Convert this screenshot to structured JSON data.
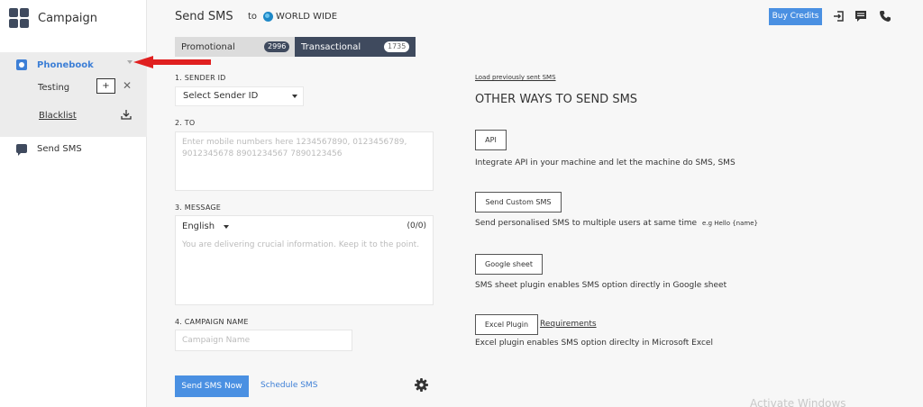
{
  "sidebar": {
    "brand": "Campaign",
    "phonebook_label": "Phonebook",
    "testing_label": "Testing",
    "plus_label": "+",
    "close_label": "✕",
    "blacklist_label": "Blacklist",
    "send_sms_label": "Send SMS"
  },
  "header": {
    "title": "Send SMS",
    "to": "to",
    "region": "WORLD WIDE",
    "buy_credits": "Buy Credits"
  },
  "tabs": {
    "promotional": "Promotional",
    "promotional_count": "2996",
    "transactional": "Transactional",
    "transactional_count": "1735"
  },
  "form": {
    "sender_label": "1. SENDER ID",
    "sender_value": "Select Sender ID",
    "to_label": "2. TO",
    "to_placeholder": "Enter mobile numbers here 1234567890, 0123456789, 9012345678 8901234567 7890123456",
    "message_label": "3. MESSAGE",
    "language": "English",
    "counter": "(0/0)",
    "message_placeholder": "You are delivering crucial information. Keep it to the point.",
    "campaign_label": "4. CAMPAIGN NAME",
    "campaign_placeholder": "Campaign Name",
    "send_now": "Send SMS Now",
    "schedule": "Schedule SMS"
  },
  "right": {
    "load_previous": "Load previously sent SMS",
    "title": "OTHER WAYS TO SEND SMS",
    "options": [
      {
        "button": "API",
        "desc": "Integrate API in your machine and let the machine do SMS, SMS"
      },
      {
        "button": "Send Custom SMS",
        "desc": "Send personalised SMS to multiple users at same time",
        "hint": "e.g Hello {name}"
      },
      {
        "button": "Google sheet",
        "desc": "SMS sheet plugin enables SMS option directly in Google sheet"
      },
      {
        "button": "Excel Plugin",
        "desc": "Excel plugin enables SMS option direclty in Microsoft Excel",
        "link": "Requirements"
      }
    ]
  },
  "watermark": "Activate Windows",
  "colors": {
    "accent": "#4a90e2",
    "dark": "#3f4a5e",
    "arrow": "#e02020"
  }
}
